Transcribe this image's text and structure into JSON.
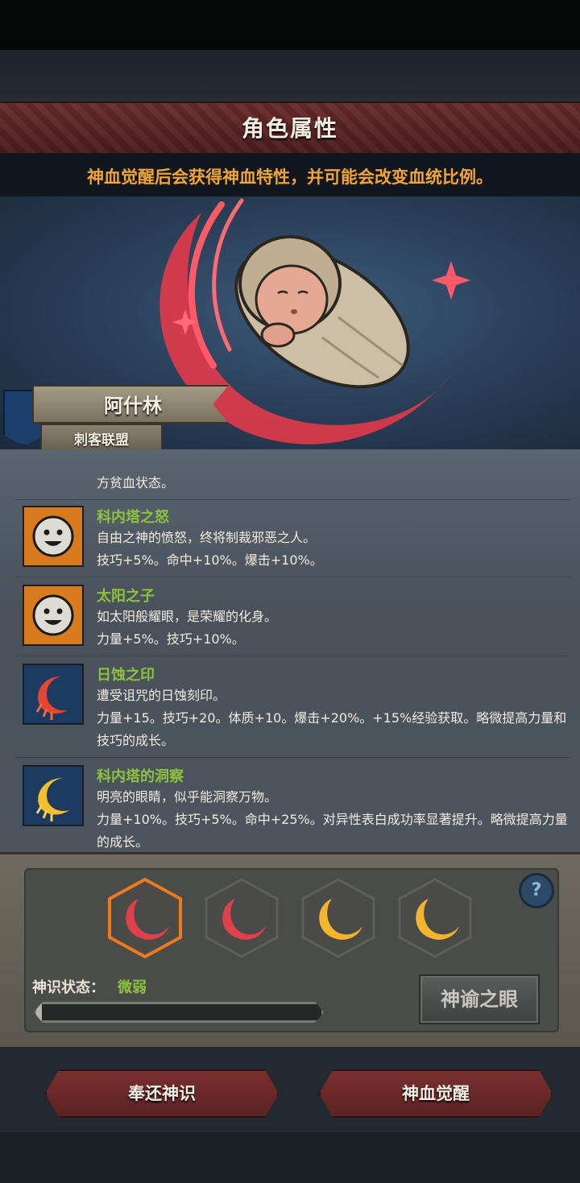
{
  "header": {
    "title": "角色属性"
  },
  "notice": "神血觉醒后会获得神血特性，并可能会改变血统比例。",
  "character": {
    "name": "阿什林",
    "guild": "刺客联盟"
  },
  "traits_list": {
    "partial_top_line": "方贫血状态。",
    "items": [
      {
        "name": "科内塔之怒",
        "icon": "smiling-sun-icon",
        "desc": "自由之神的愤怒，终将制裁邪恶之人。",
        "stats": "技巧+5%。命中+10%。爆击+10%。"
      },
      {
        "name": "太阳之子",
        "icon": "smiling-sun-icon",
        "desc": "如太阳般耀眼，是荣耀的化身。",
        "stats": "力量+5%。技巧+10%。"
      },
      {
        "name": "日蚀之印",
        "icon": "red-crescent-icon",
        "desc": "遭受诅咒的日蚀刻印。",
        "stats": "力量+15。技巧+20。体质+10。爆击+20%。+15%经验获取。略微提高力量和技巧的成长。"
      },
      {
        "name": "科内塔的洞察",
        "icon": "gold-crescent-icon",
        "desc": "明亮的眼睛，似乎能洞察万物。",
        "stats": "力量+10%。技巧+5%。命中+25%。对异性表白成功率显著提升。略微提高力量的成长。"
      }
    ]
  },
  "divine_panel": {
    "slots": [
      {
        "icon": "red-crescent-slot-icon",
        "color": "#e0404a",
        "selected": true
      },
      {
        "icon": "red-crescent-slot-icon",
        "color": "#e0404a",
        "selected": false
      },
      {
        "icon": "gold-crescent-slot-icon",
        "color": "#f2b52c",
        "selected": false
      },
      {
        "icon": "gold-crescent-slot-icon",
        "color": "#f2b52c",
        "selected": false
      }
    ],
    "status_label": "神识状态：",
    "status_value": "微弱",
    "progress": 0.02,
    "eye_button": "神谕之眼",
    "help_icon": "question-icon"
  },
  "actions": {
    "return_label": "奉还神识",
    "awaken_label": "神血觉醒"
  },
  "colors": {
    "accent_green": "#8ec23c",
    "accent_orange": "#f0a43a",
    "button_red": "#6a2b2a"
  }
}
